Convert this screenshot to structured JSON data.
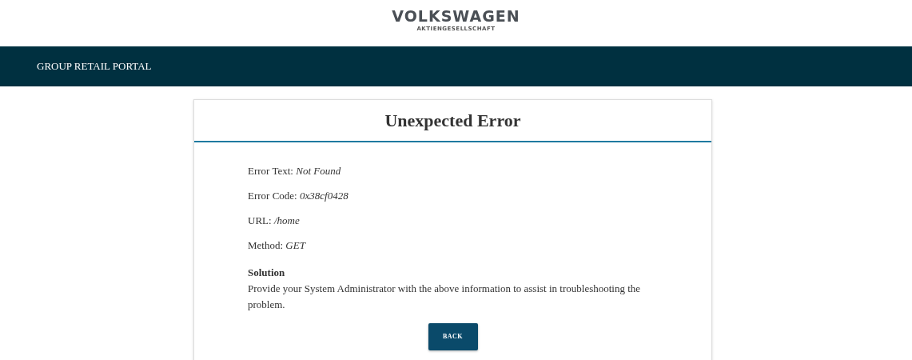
{
  "logo": {
    "name": "VOLKSWAGEN",
    "subtitle": "AKTIENGESELLSCHAFT"
  },
  "navbar": {
    "title": "GROUP RETAIL PORTAL"
  },
  "card": {
    "title": "Unexpected Error",
    "details": [
      "Error Text: *Not Found*",
      "Error Code: *0x38cf0428*",
      "URL: */home*",
      "Method: *GET*"
    ],
    "solution": {
      "heading": "Solution",
      "text": "Provide your System Administrator with the above information to assist in troubleshooting the problem."
    },
    "button": "BACK"
  }
}
